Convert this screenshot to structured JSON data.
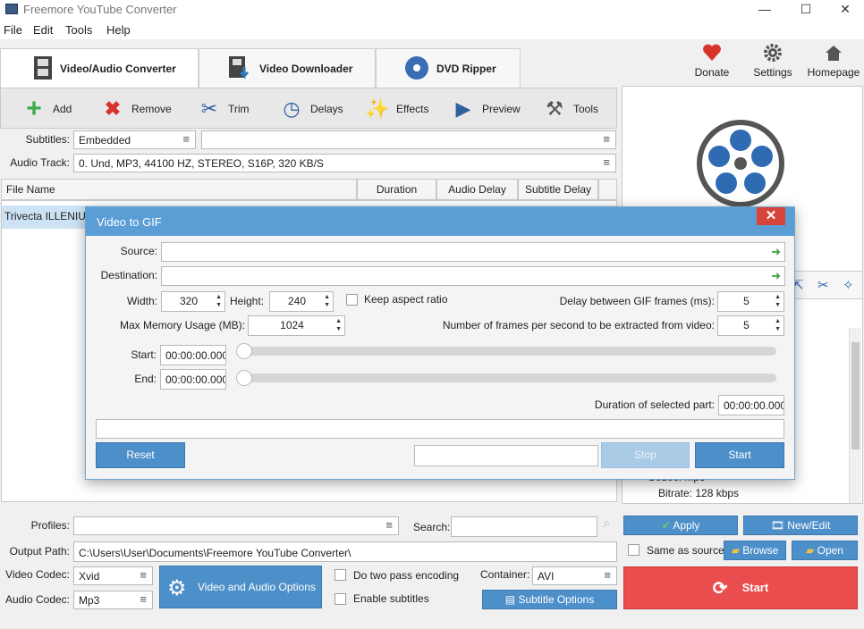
{
  "window": {
    "title": "Freemore YouTube Converter"
  },
  "menu": [
    "File",
    "Edit",
    "Tools",
    "Help"
  ],
  "tabs": [
    {
      "label": "Video/Audio Converter",
      "active": true
    },
    {
      "label": "Video Downloader",
      "active": false
    },
    {
      "label": "DVD Ripper",
      "active": false
    }
  ],
  "top_actions": {
    "donate": "Donate",
    "settings": "Settings",
    "homepage": "Homepage"
  },
  "toolbar": {
    "add": "Add",
    "remove": "Remove",
    "trim": "Trim",
    "delays": "Delays",
    "effects": "Effects",
    "preview": "Preview",
    "tools": "Tools"
  },
  "subtitles": {
    "label": "Subtitles:",
    "value": "Embedded"
  },
  "audio_track": {
    "label": "Audio Track:",
    "value": "0. Und, MP3, 44100 HZ, STEREO, S16P, 320 KB/S"
  },
  "file_list": {
    "columns": [
      "File Name",
      "Duration",
      "Audio Delay",
      "Subtitle Delay"
    ],
    "rows": [
      {
        "name": "Trivecta ILLENIUM"
      }
    ]
  },
  "info_panel": {
    "codec": "Codec: mp3",
    "bitrate": "Bitrate: 128 kbps"
  },
  "dialog": {
    "title": "Video to GIF",
    "source_label": "Source:",
    "destination_label": "Destination:",
    "width_label": "Width:",
    "width_value": "320",
    "height_label": "Height:",
    "height_value": "240",
    "keep_aspect_label": "Keep aspect ratio",
    "delay_label": "Delay between GIF frames (ms):",
    "delay_value": "5",
    "max_memory_label": "Max Memory Usage (MB):",
    "max_memory_value": "1024",
    "fps_label": "Number of frames per second to be extracted from video:",
    "fps_value": "5",
    "start_label": "Start:",
    "start_value": "00:00:00.000",
    "end_label": "End:",
    "end_value": "00:00:00.000",
    "duration_label": "Duration of selected part:",
    "duration_value": "00:00:00.000",
    "reset": "Reset",
    "stop": "Stop",
    "start": "Start"
  },
  "bottom": {
    "profiles_label": "Profiles:",
    "search_label": "Search:",
    "apply": "Apply",
    "new_edit": "New/Edit",
    "output_label": "Output Path:",
    "output_value": "C:\\Users\\User\\Documents\\Freemore YouTube Converter\\",
    "same_as_source": "Same as source",
    "browse": "Browse",
    "open": "Open",
    "video_codec_label": "Video Codec:",
    "video_codec_value": "Xvid",
    "audio_codec_label": "Audio Codec:",
    "audio_codec_value": "Mp3",
    "options_button": "Video and Audio Options",
    "two_pass": "Do two pass encoding",
    "enable_subtitles": "Enable subtitles",
    "container_label": "Container:",
    "container_value": "AVI",
    "subtitle_options": "Subtitle Options",
    "start": "Start"
  }
}
